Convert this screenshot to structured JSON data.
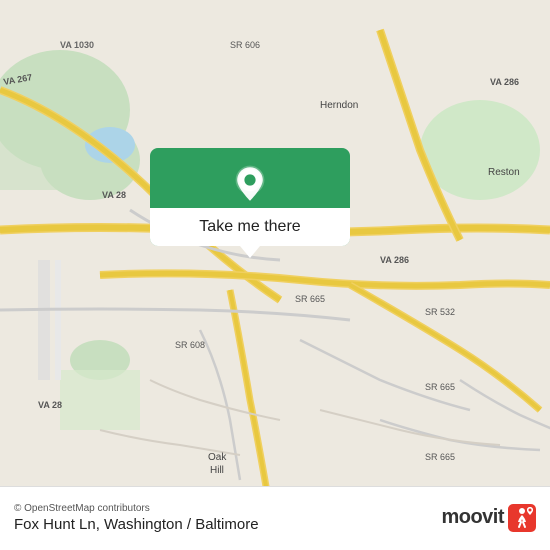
{
  "map": {
    "attribution": "© OpenStreetMap contributors",
    "location_name": "Fox Hunt Ln, Washington / Baltimore",
    "background_color": "#ede9e0"
  },
  "popup": {
    "button_label": "Take me there",
    "pin_color": "#ffffff"
  },
  "branding": {
    "name": "moovit",
    "icon_color_top": "#e8372c",
    "icon_color_bottom": "#c0392b"
  }
}
